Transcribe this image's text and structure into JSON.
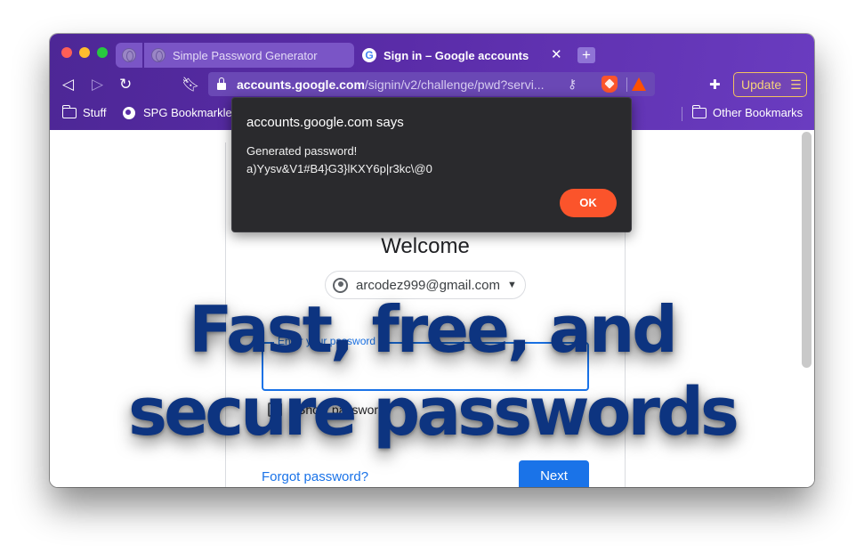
{
  "browser": {
    "tabs": [
      {
        "label": "Simple Password Generator",
        "icon": "globe-icon"
      },
      {
        "label": "Sign in – Google accounts",
        "icon": "google-icon",
        "active": true
      }
    ],
    "address": {
      "host": "accounts.google.com",
      "path": "/signin/v2/challenge/pwd?servi..."
    },
    "update_label": "Update",
    "bookmarks": [
      {
        "label": "Stuff",
        "icon": "folder-icon"
      },
      {
        "label": "SPG Bookmarklet",
        "icon": "globe-icon"
      },
      {
        "label": "Other Bookmarks",
        "icon": "folder-icon"
      }
    ]
  },
  "dialog": {
    "title": "accounts.google.com says",
    "message_line1": "Generated password!",
    "message_line2": "a)Yysv&V1#B4}G3}lKXY6p|r3kc\\@0",
    "ok_label": "OK"
  },
  "signin": {
    "welcome": "Welcome",
    "account_email": "arcodez999@gmail.com",
    "password_label": "Enter your password",
    "show_password_label": "Show password",
    "forgot_label": "Forgot password?",
    "next_label": "Next"
  },
  "overlay": {
    "line1": "Fast, free, and",
    "line2": "secure passwords"
  },
  "colors": {
    "chrome": "#5a2ca8",
    "headline": "#0d3480",
    "google_blue": "#1a73e8",
    "brave_orange": "#fb542b"
  }
}
